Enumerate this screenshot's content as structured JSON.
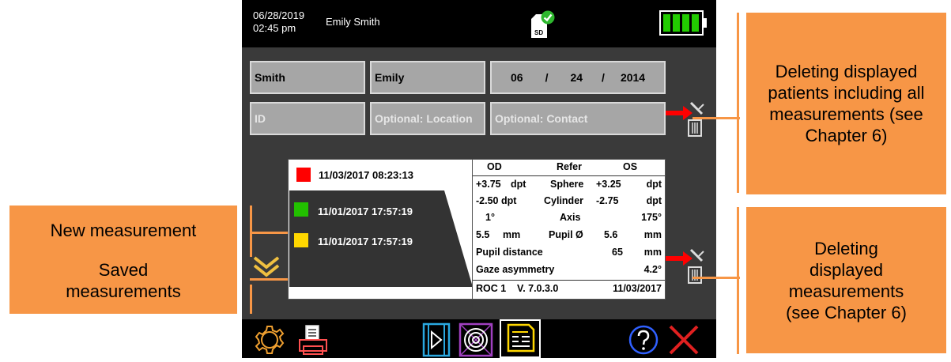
{
  "status": {
    "date": "06/28/2019",
    "time": "02:45 pm",
    "patient_name": "Emily Smith",
    "sd_label": "SD"
  },
  "patient": {
    "last_name": "Smith",
    "first_name": "Emily",
    "dob_month": "06",
    "dob_day": "24",
    "dob_year": "2014",
    "dob_sep": "/",
    "id_placeholder": "ID",
    "location_placeholder": "Optional: Location",
    "contact_placeholder": "Optional: Contact"
  },
  "measurements": [
    {
      "datetime": "11/03/2017 08:23:13",
      "color": "#ff0000"
    },
    {
      "datetime": "11/01/2017 17:57:19",
      "color": "#22c000"
    },
    {
      "datetime": "11/01/2017 17:57:19",
      "color": "#ffd700"
    }
  ],
  "results": {
    "header": {
      "od": "OD",
      "refer": "Refer",
      "os": "OS"
    },
    "sphere": {
      "od": "+3.75",
      "od_unit": "dpt",
      "label": "Sphere",
      "os": "+3.25",
      "os_unit": "dpt"
    },
    "cylinder": {
      "od": "-2.50 dpt",
      "label": "Cylinder",
      "os": "-2.75",
      "os_unit": "dpt"
    },
    "axis": {
      "od": "1°",
      "label": "Axis",
      "os": "175°"
    },
    "pupil": {
      "od": "5.5",
      "od_unit": "mm",
      "label": "Pupil Ø",
      "os": "5.6",
      "os_unit": "mm"
    },
    "pupil_distance": {
      "label": "Pupil distance",
      "value": "65",
      "unit": "mm"
    },
    "gaze": {
      "label": "Gaze asymmetry",
      "value": "4.2°"
    },
    "footer": {
      "device": "ROC 1",
      "version": "V. 7.0.3.0",
      "date": "11/03/2017"
    }
  },
  "callouts": {
    "new_measurement": "New measurement",
    "saved_measurements": "Saved measurements",
    "delete_patients": "Deleting displayed patients including all measurements (see Chapter 6)",
    "delete_measurements": "Deleting displayed measurements (see Chapter 6)"
  },
  "colors": {
    "callout": "#f79646",
    "battery": "#22cc00",
    "close": "#e02020",
    "video": "#2aa8e0",
    "target": "#a040c0",
    "report": "#ffd700",
    "settings": "#f0a030",
    "print": "#ff5050",
    "help": "#3060ff"
  }
}
